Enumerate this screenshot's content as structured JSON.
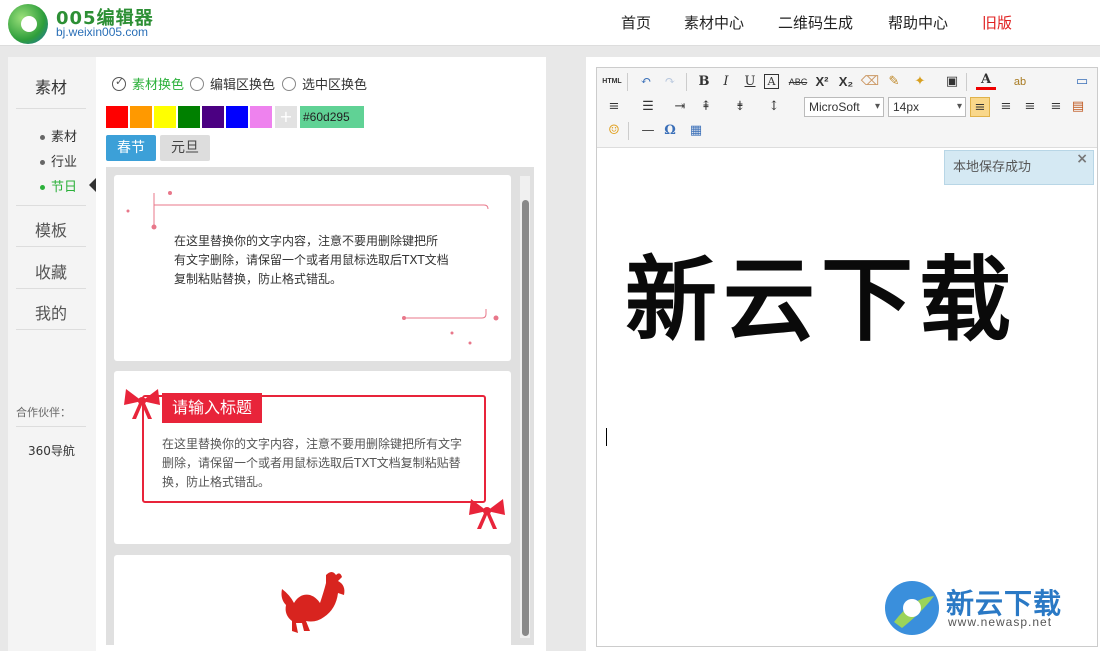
{
  "header": {
    "logo_title": "005编辑器",
    "logo_url": "bj.weixin005.com",
    "nav": [
      "首页",
      "素材中心",
      "二维码生成",
      "帮助中心",
      "旧版"
    ]
  },
  "sidebar": {
    "title": "素材",
    "sub_items": [
      "素材",
      "行业",
      "节日"
    ],
    "items": [
      "模板",
      "收藏",
      "我的"
    ],
    "partner_label": "合作伙伴：",
    "partner_link": "360导航"
  },
  "color_mode": {
    "options": [
      "素材换色",
      "编辑区换色",
      "选中区换色"
    ],
    "selected": "素材换色"
  },
  "swatches": [
    "#ff0000",
    "#ff9900",
    "#ffff00",
    "#008000",
    "#4b0082",
    "#0000ff",
    "#ee82ee"
  ],
  "hex_value": "#60d295",
  "tabs": [
    "春节",
    "元旦"
  ],
  "cards": [
    {
      "text": "在这里替换你的文字内容，注意不要用删除键把所有文字删除，请保留一个或者用鼠标选取后TXT文档复制粘贴替换，防止格式错乱。"
    },
    {
      "title": "请输入标题",
      "text": "在这里替换你的文字内容，注意不要用删除键把所有文字删除，请保留一个或者用鼠标选取后TXT文档复制粘贴替换，防止格式错乱。"
    }
  ],
  "editor": {
    "font_select": "MicroSoft",
    "size_select": "14px",
    "toast": "本地保存成功",
    "calligraphy_text": "新云下载"
  },
  "watermark": {
    "text": "新云下载",
    "url": "www.newasp.net"
  },
  "colors": {
    "accent_green": "#2bb03a",
    "accent_blue": "#3ca0d8",
    "accent_red": "#e8243a"
  }
}
